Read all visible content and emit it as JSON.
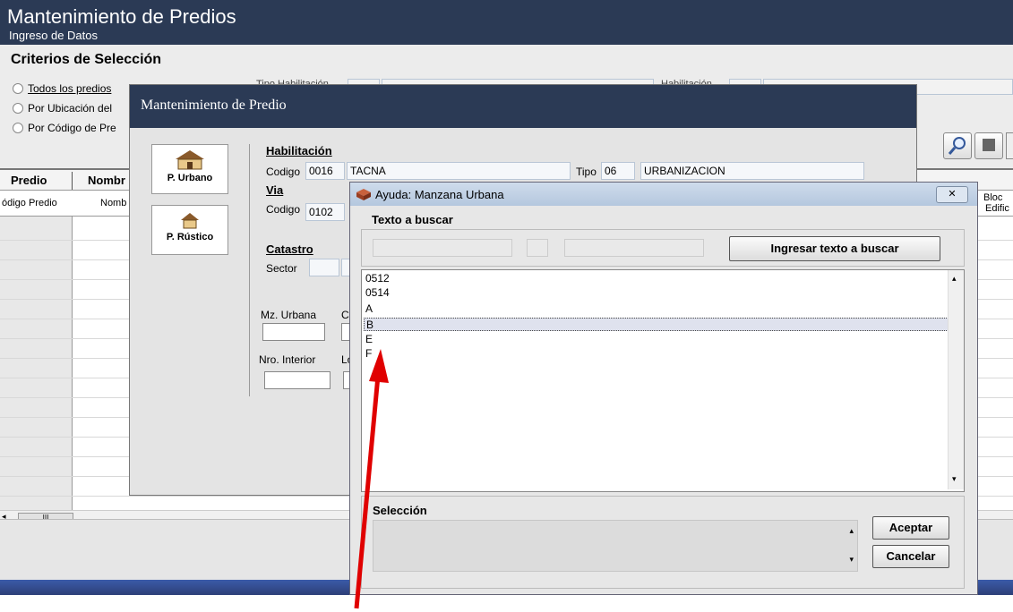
{
  "app": {
    "title": "Mantenimiento de Predios",
    "subtitle": "Ingreso de Datos"
  },
  "criteria": {
    "title": "Criterios de Selección",
    "options": [
      "Todos los predios",
      "Por Ubicación del",
      "Por Código de Pre"
    ],
    "tipo_hab_label": "Tipo Habilitación",
    "hab_label": "Habilitación"
  },
  "grid": {
    "headers": [
      "Predio",
      "Nombr"
    ],
    "subheaders": [
      "ódigo Predio",
      "Nomb"
    ],
    "right_headers": [
      "Bloc",
      "Edific"
    ],
    "scroll_label": "III"
  },
  "dialog1": {
    "title": "Mantenimiento de Predio",
    "btn_urbano": "P. Urbano",
    "btn_rustico": "P. Rústico",
    "habilitacion": {
      "section": "Habilitación",
      "codigo_label": "Codigo",
      "codigo": "0016",
      "nombre": "TACNA",
      "tipo_label": "Tipo",
      "tipo": "06",
      "tipo_nombre": "URBANIZACION"
    },
    "via": {
      "section": "Via",
      "codigo_label": "Codigo",
      "codigo": "0102"
    },
    "catastro": {
      "section": "Catastro",
      "sector_label": "Sector"
    },
    "mz_label": "Mz. Urbana",
    "mz_next": "C",
    "nro_label": "Nro. Interior",
    "nro_next": "Lo"
  },
  "dialog2": {
    "title": "Ayuda: Manzana Urbana",
    "close": "✕",
    "search_label": "Texto a buscar",
    "search_button": "Ingresar texto a buscar",
    "items": [
      "0512",
      "0514",
      "A",
      "B",
      "E",
      "F"
    ],
    "selected_index": 3,
    "selection_label": "Selección",
    "accept": "Aceptar",
    "cancel": "Cancelar"
  },
  "colors": {
    "title_bar": "#2b3a55",
    "arrow": "#e00000"
  }
}
